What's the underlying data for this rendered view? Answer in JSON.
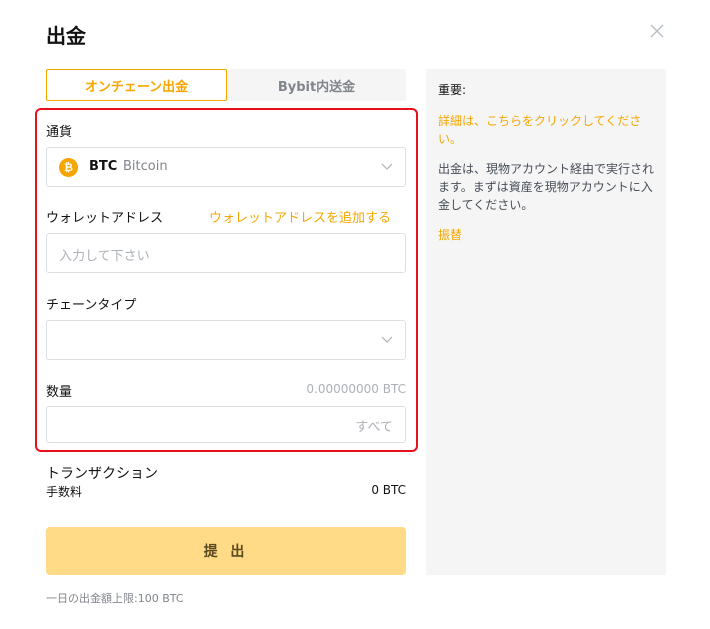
{
  "header": {
    "title": "出金"
  },
  "tabs": [
    {
      "label": "オンチェーン出金",
      "active": true
    },
    {
      "label": "Bybit内送金",
      "active": false
    }
  ],
  "form": {
    "currency": {
      "label": "通貨",
      "selected_symbol": "BTC",
      "selected_name": "Bitcoin",
      "icon": "bitcoin-icon"
    },
    "address": {
      "label": "ウォレットアドレス",
      "add_link": "ウォレットアドレスを追加する",
      "placeholder": "入力して下さい",
      "value": ""
    },
    "chain": {
      "label": "チェーンタイプ",
      "value": ""
    },
    "amount": {
      "label": "数量",
      "available": "0.00000000 BTC",
      "value": "",
      "all_label": "すべて"
    }
  },
  "fee": {
    "title": "トランザクション",
    "label": "手数料",
    "value": "0 BTC"
  },
  "submit_label": "提 出",
  "limit_text": "一日の出金額上限:100 BTC",
  "notice": {
    "title": "重要:",
    "link": "詳細は、こちらをクリックしてください。",
    "body": "出金は、現物アカウント経由で実行されます。まずは資産を現物アカウントに入金してください。",
    "transfer": "振替"
  },
  "colors": {
    "accent": "#f7a600",
    "highlight_border": "#e8101c",
    "submit_bg": "#ffda87",
    "panel_bg": "#f5f5f5"
  }
}
